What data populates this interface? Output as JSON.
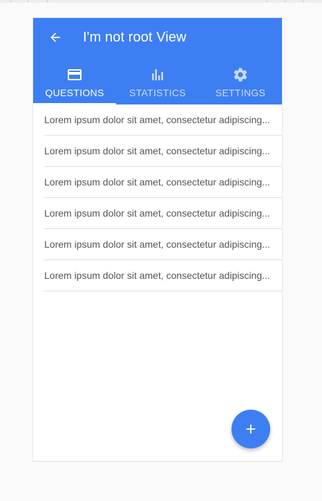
{
  "header": {
    "title": "I'm not root View",
    "back_icon": "arrow-back-icon"
  },
  "tabs": [
    {
      "label": "QUESTIONS",
      "icon": "credit-card-icon",
      "active": true
    },
    {
      "label": "STATISTICS",
      "icon": "bar-chart-icon",
      "active": false
    },
    {
      "label": "SETTINGS",
      "icon": "gear-icon",
      "active": false
    }
  ],
  "list": {
    "items": [
      "Lorem ipsum dolor sit amet, consectetur adipiscing...",
      "Lorem ipsum dolor sit amet, consectetur adipiscing...",
      "Lorem ipsum dolor sit amet, consectetur adipiscing...",
      "Lorem ipsum dolor sit amet, consectetur adipiscing...",
      "Lorem ipsum dolor sit amet, consectetur adipiscing...",
      "Lorem ipsum dolor sit amet, consectetur adipiscing..."
    ]
  },
  "fab": {
    "icon": "plus-icon"
  },
  "colors": {
    "primary": "#3d7ff2",
    "background": "#fafafa",
    "divider": "#e0e0e0"
  }
}
